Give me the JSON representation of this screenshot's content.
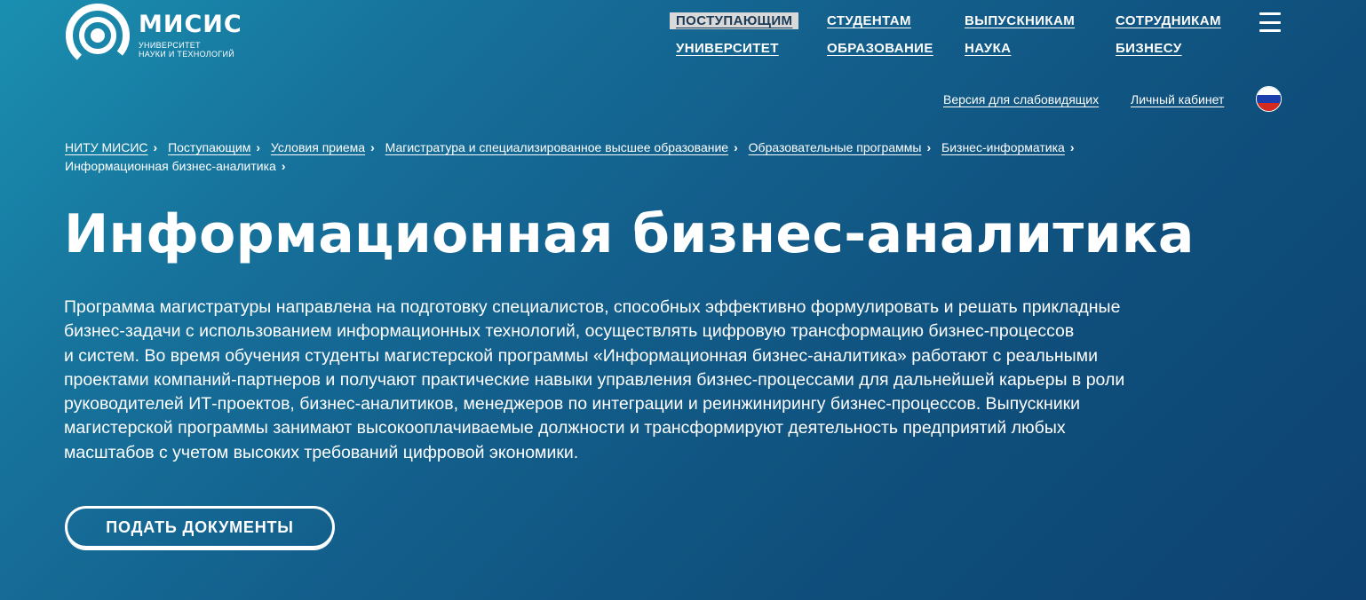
{
  "logo": {
    "name": "МИСИС",
    "subtitle_line1": "УНИВЕРСИТЕТ",
    "subtitle_line2": "НАУКИ И ТЕХНОЛОГИЙ"
  },
  "nav": {
    "items": [
      {
        "label": "ПОСТУПАЮЩИМ",
        "active": true
      },
      {
        "label": "СТУДЕНТАМ"
      },
      {
        "label": "ВЫПУСКНИКАМ"
      },
      {
        "label": "СОТРУДНИКАМ"
      },
      {
        "label": "УНИВЕРСИТЕТ"
      },
      {
        "label": "ОБРАЗОВАНИЕ"
      },
      {
        "label": "НАУКА"
      },
      {
        "label": "БИЗНЕСУ"
      }
    ],
    "menu_icon": "hamburger-menu-icon"
  },
  "utility": {
    "vision_label": "Версия для слабовидящих",
    "cabinet_label": "Личный кабинет",
    "language_icon": "russian-flag-icon",
    "flag_colors": [
      "#ffffff",
      "#1c3fae",
      "#d52b1e"
    ]
  },
  "breadcrumbs": {
    "items": [
      "НИТУ МИСИС",
      "Поступающим",
      "Условия приема",
      "Магистратура и специализированное высшее образование",
      "Образовательные программы",
      "Бизнес-информатика"
    ],
    "current": "Информационная бизнес-аналитика"
  },
  "page": {
    "title": "Информационная бизнес-аналитика",
    "description_lines": [
      "Программа магистратуры направлена на подготовку специалистов, способных эффективно формулировать и решать прикладные",
      "бизнес-задачи с использованием информационных технологий, осуществлять цифровую трансформацию бизнес-процессов",
      "и систем. Во время обучения студенты магистерской программы «Информационная бизнес-аналитика» работают с реальными",
      "проектами компаний-партнеров и получают практические навыки управления бизнес-процессами для дальнейшей карьеры в роли",
      "руководителей ИТ-проектов, бизнес-аналитиков, менеджеров по интеграции и реинжинирингу бизнес-процессов. Выпускники",
      "магистерской программы занимают высокооплачиваемые должности и трансформируют деятельность предприятий любых",
      "масштабов с учетом высоких требований цифровой экономики."
    ],
    "cta_label": "ПОДАТЬ ДОКУМЕНТЫ"
  }
}
